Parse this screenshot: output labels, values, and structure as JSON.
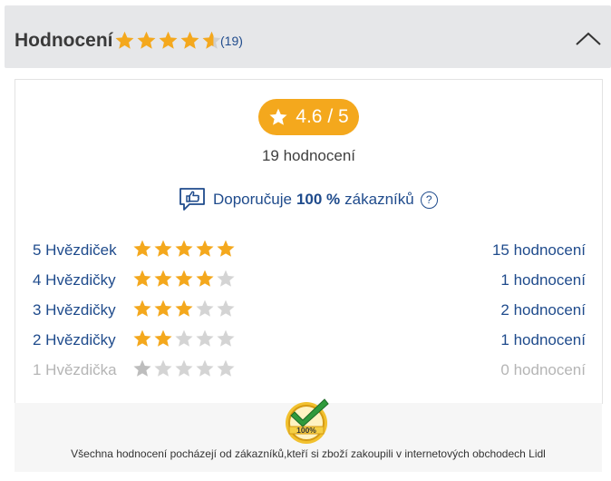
{
  "header": {
    "title": "Hodnocení",
    "count": "(19)",
    "average_stars": 4.6
  },
  "summary": {
    "score": "4.6 / 5",
    "total": "19 hodnocení",
    "recommend_prefix": "Doporučuje",
    "recommend_percent": "100 %",
    "recommend_suffix": "zákazníků",
    "help_icon": "?"
  },
  "rows": [
    {
      "label": "5 Hvězdiček",
      "stars": 5,
      "count": "15 hodnocení"
    },
    {
      "label": "4 Hvězdičky",
      "stars": 4,
      "count": "1 hodnocení"
    },
    {
      "label": "3 Hvězdičky",
      "stars": 3,
      "count": "2 hodnocení"
    },
    {
      "label": "2 Hvězdičky",
      "stars": 2,
      "count": "1 hodnocení"
    },
    {
      "label": "1 Hvězdička",
      "stars": 1,
      "count": "0 hodnocení"
    }
  ],
  "footer": {
    "seal_label": "100%",
    "text": "Všechna hodnocení pocházejí od zákazníků,kteří si zboží zakoupili v internetových obchodech Lidl"
  },
  "colors": {
    "star": "#f4a81d",
    "star_empty": "#cfcfcf",
    "link": "#1f4b8c",
    "header_bg": "#e6e7e9"
  }
}
